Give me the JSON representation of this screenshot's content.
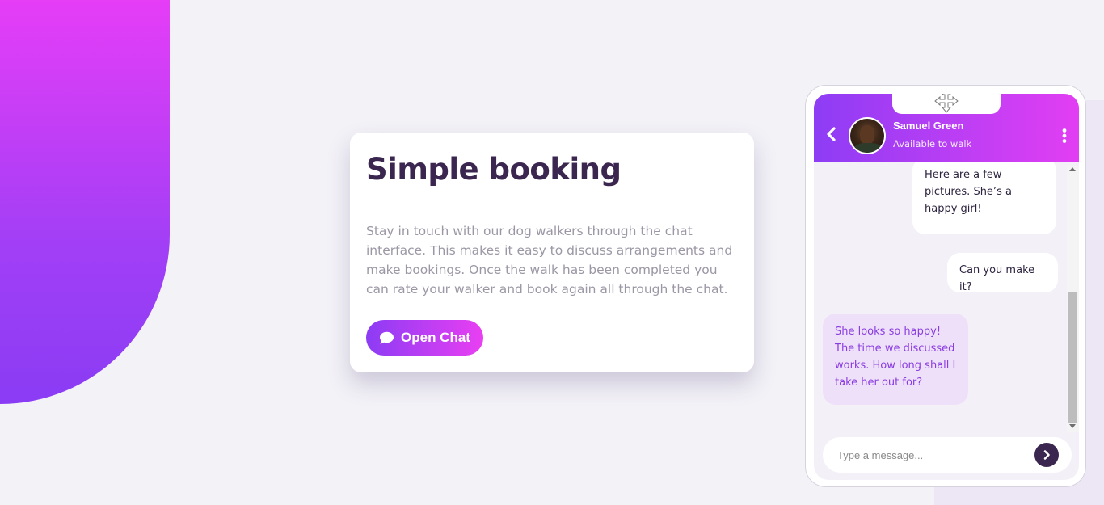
{
  "card": {
    "title": "Simple booking",
    "description": "Stay in touch with our dog walkers through the chat interface. This makes it easy to discuss arrangements and make bookings. Once the walk has been completed you can rate your walker and book again all through the chat.",
    "button_label": "Open Chat",
    "button_icon": "chat-bubble-icon"
  },
  "chat": {
    "contact": {
      "name": "Samuel Green",
      "status": "Available to walk"
    },
    "messages": [
      {
        "from": "me",
        "text": "Here are a few pictures. She’s a happy girl!"
      },
      {
        "from": "me",
        "text": "Can you make it?"
      },
      {
        "from": "walker",
        "text": "She looks so happy! The time we discussed works. How long shall I take her out for?"
      }
    ],
    "input": {
      "placeholder": "Type a message...",
      "value": ""
    },
    "icons": {
      "back": "chevron-left-icon",
      "more": "more-vertical-icon",
      "send": "chevron-right-icon",
      "move": "move-cursor-icon"
    }
  },
  "colors": {
    "background": "#f3f2f7",
    "accent_start": "#8c3cf4",
    "accent_end": "#e93ff2",
    "title_text": "#3b2650",
    "body_text": "#9b97a5",
    "walker_bubble": "#eee0f8",
    "walker_text": "#8a3de0",
    "send_button": "#3b2650"
  }
}
